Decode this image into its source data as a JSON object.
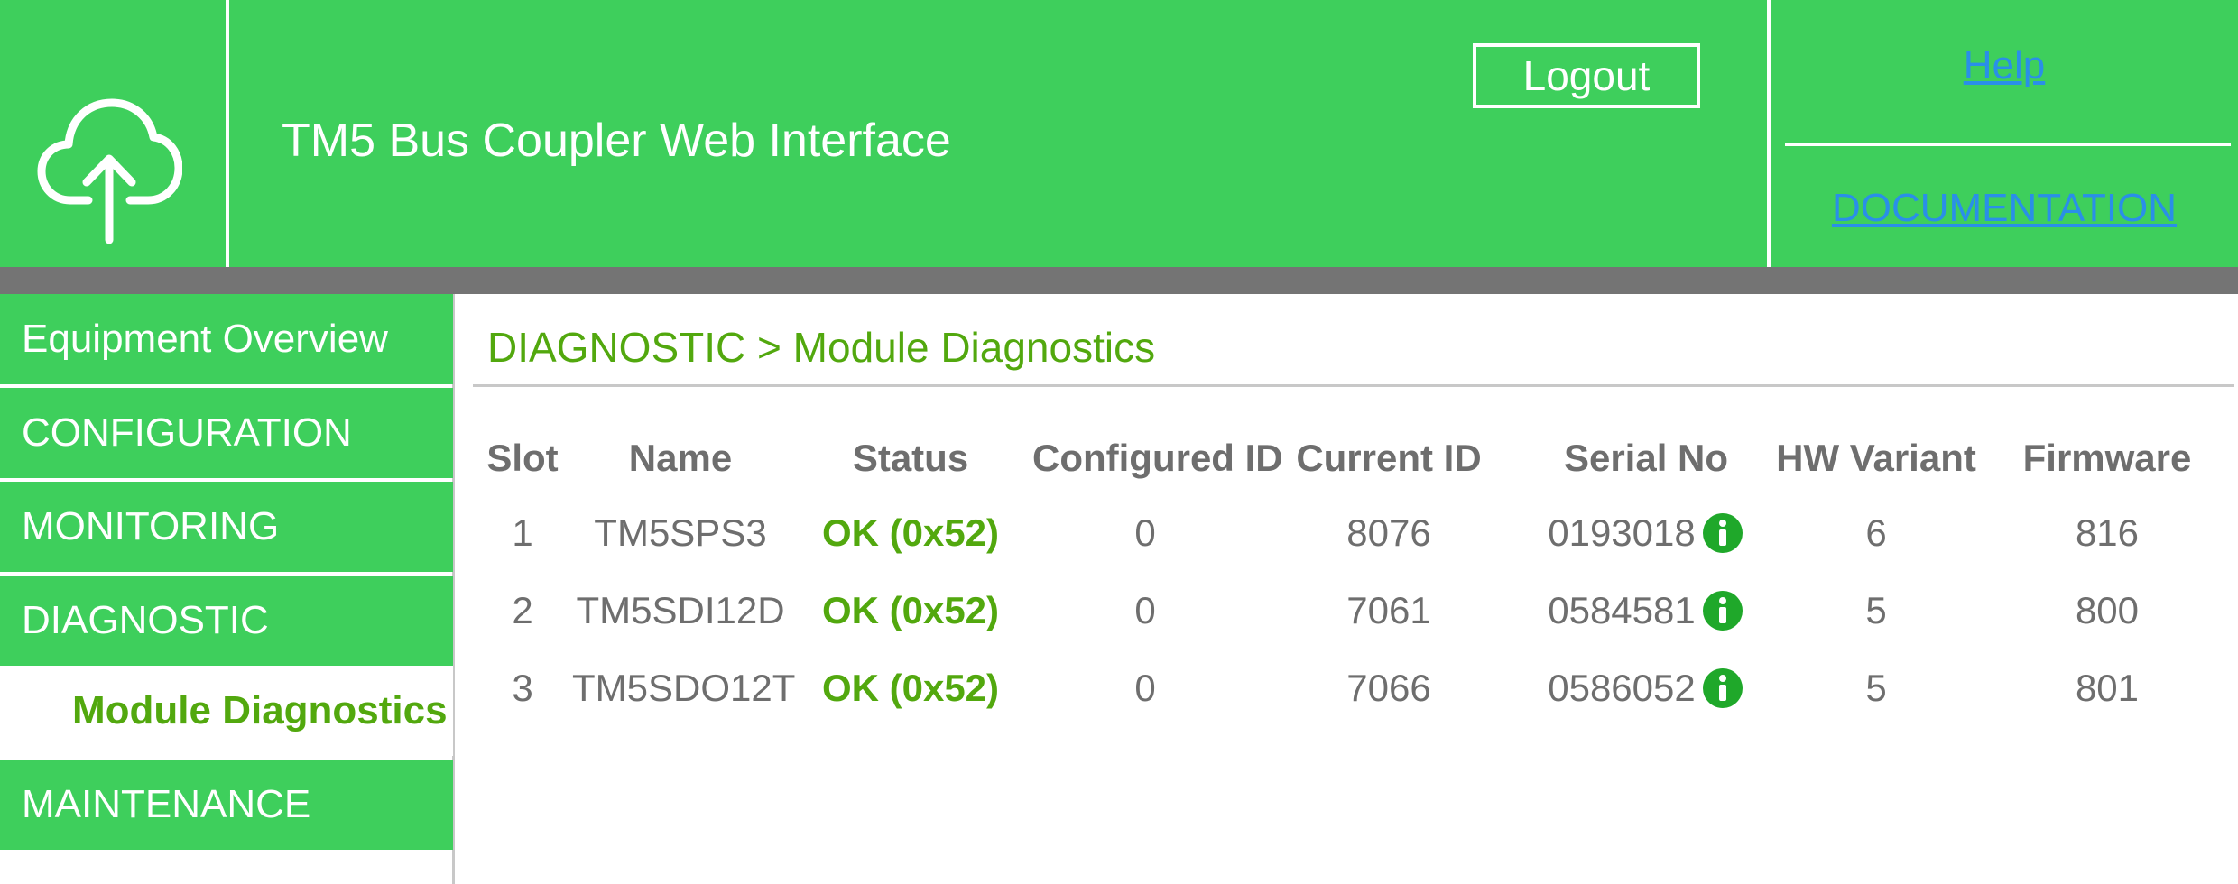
{
  "header": {
    "title": "TM5 Bus Coupler Web Interface",
    "logo_icon": "cloud-upload-icon",
    "logout_label": "Logout",
    "help_label": "Help",
    "documentation_label": "DOCUMENTATION"
  },
  "colors": {
    "brand_green": "#3ecf5c",
    "status_green": "#52a80e",
    "link_blue": "#2a8fe8",
    "band_gray": "#747474"
  },
  "sidebar": {
    "items": [
      {
        "label": "Equipment Overview"
      },
      {
        "label": "CONFIGURATION"
      },
      {
        "label": "MONITORING"
      },
      {
        "label": "DIAGNOSTIC"
      },
      {
        "label": "Module Diagnostics",
        "active": true
      },
      {
        "label": "MAINTENANCE"
      }
    ]
  },
  "main": {
    "breadcrumb": "DIAGNOSTIC > Module Diagnostics",
    "table": {
      "columns": [
        "Slot",
        "Name",
        "Status",
        "Configured ID",
        "Current ID",
        "Serial No",
        "HW Variant",
        "Firmware"
      ],
      "rows": [
        {
          "slot": "1",
          "name": "TM5SPS3",
          "status": "OK (0x52)",
          "configured_id": "0",
          "current_id": "8076",
          "serial_no": "0193018",
          "hw_variant": "6",
          "firmware": "816",
          "serial_icon": "info-icon"
        },
        {
          "slot": "2",
          "name": "TM5SDI12D",
          "status": "OK (0x52)",
          "configured_id": "0",
          "current_id": "7061",
          "serial_no": "0584581",
          "hw_variant": "5",
          "firmware": "800",
          "serial_icon": "info-icon"
        },
        {
          "slot": "3",
          "name": "TM5SDO12T",
          "status": "OK (0x52)",
          "configured_id": "0",
          "current_id": "7066",
          "serial_no": "0586052",
          "hw_variant": "5",
          "firmware": "801",
          "serial_icon": "info-icon"
        }
      ]
    }
  }
}
